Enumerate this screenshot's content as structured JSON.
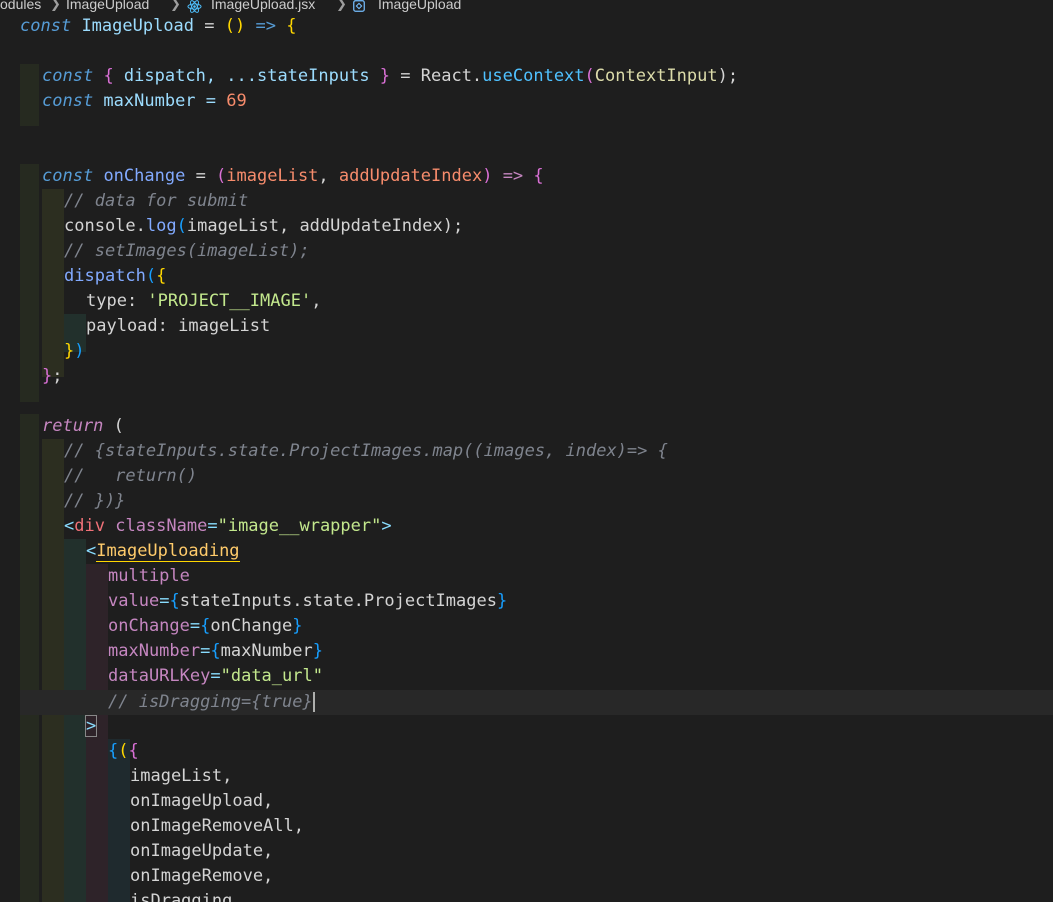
{
  "breadcrumb": {
    "items": [
      "odules",
      "ImageUpload",
      "ImageUpload.jsx",
      "ImageUpload"
    ],
    "icons": [
      "react-icon",
      "symbol-icon"
    ]
  },
  "code": {
    "lines": [
      "const ImageUpload = () => {",
      "",
      "const { dispatch, ...stateInputs } = React.useContext(ContextInput);",
      "const maxNumber = 69",
      "",
      "",
      "const onChange = (imageList, addUpdateIndex) => {",
      "// data for submit",
      "console.log(imageList, addUpdateIndex);",
      "// setImages(imageList);",
      "dispatch({",
      "type: 'PROJECT__IMAGE',",
      "payload: imageList",
      "})",
      "};",
      "",
      "return (",
      "// {stateInputs.state.ProjectImages.map((images, index)=> {",
      "//   return()",
      "// })}",
      "<div className=\"image__wrapper\">",
      "<ImageUploading",
      "multiple",
      "value={stateInputs.state.ProjectImages}",
      "onChange={onChange}",
      "maxNumber={maxNumber}",
      "dataURLKey=\"data_url\"",
      "// isDragging={true}",
      ">",
      "{({",
      "imageList,",
      "onImageUpload,",
      "onImageRemoveAll,",
      "onImageUpdate,",
      "onImageRemove,",
      "isDragging,"
    ]
  },
  "tokens": {
    "l0": [
      "const",
      " ",
      "ImageUpload",
      " = ",
      "()",
      " => ",
      "{"
    ],
    "l2": [
      "const",
      " ",
      "{",
      " dispatch, ...stateInputs ",
      "}",
      " = React.",
      "useContext",
      "(",
      "ContextInput",
      ");"
    ],
    "l3": [
      "const",
      " maxNumber = ",
      "69"
    ],
    "l6": [
      "const",
      " ",
      "onChange",
      " = ",
      "(",
      "imageList",
      ", ",
      "addUpdateIndex",
      ")",
      " => ",
      "{"
    ],
    "l7": [
      "// data for submit"
    ],
    "l8": [
      "console.",
      "log",
      "(",
      "imageList, addUpdateIndex",
      ");"
    ],
    "l9": [
      "// setImages(imageList);"
    ],
    "l10": [
      "dispatch",
      "(",
      "{"
    ],
    "l11": [
      "type: ",
      "'PROJECT__IMAGE'",
      ","
    ],
    "l12": [
      "payload: imageList"
    ],
    "l13": [
      "}",
      ")"
    ],
    "l14": [
      "}",
      ";"
    ],
    "l16": [
      "return",
      " ("
    ],
    "l17": [
      "// {stateInputs.state.ProjectImages.map((images, index)=> {"
    ],
    "l18": [
      "//   return()"
    ],
    "l19": [
      "// })}"
    ],
    "l20": [
      "<",
      "div",
      " ",
      "className",
      "=",
      "\"image__wrapper\"",
      ">"
    ],
    "l21": [
      "<",
      "ImageUploading"
    ],
    "l22": [
      "multiple"
    ],
    "l23": [
      "value",
      "=",
      "{",
      "stateInputs.state.ProjectImages",
      "}"
    ],
    "l24": [
      "onChange",
      "=",
      "{",
      "onChange",
      "}"
    ],
    "l25": [
      "maxNumber",
      "=",
      "{",
      "maxNumber",
      "}"
    ],
    "l26": [
      "dataURLKey",
      "=",
      "\"data_url\""
    ],
    "l27": [
      "// isDragging={true}"
    ],
    "l28": [
      ">"
    ],
    "l29": [
      "{",
      "(",
      "{"
    ],
    "l30": [
      "imageList,"
    ],
    "l31": [
      "onImageUpload,"
    ],
    "l32": [
      "onImageRemoveAll,"
    ],
    "l33": [
      "onImageUpdate,"
    ],
    "l34": [
      "onImageRemove,"
    ],
    "l35": [
      "isDragging,"
    ]
  }
}
